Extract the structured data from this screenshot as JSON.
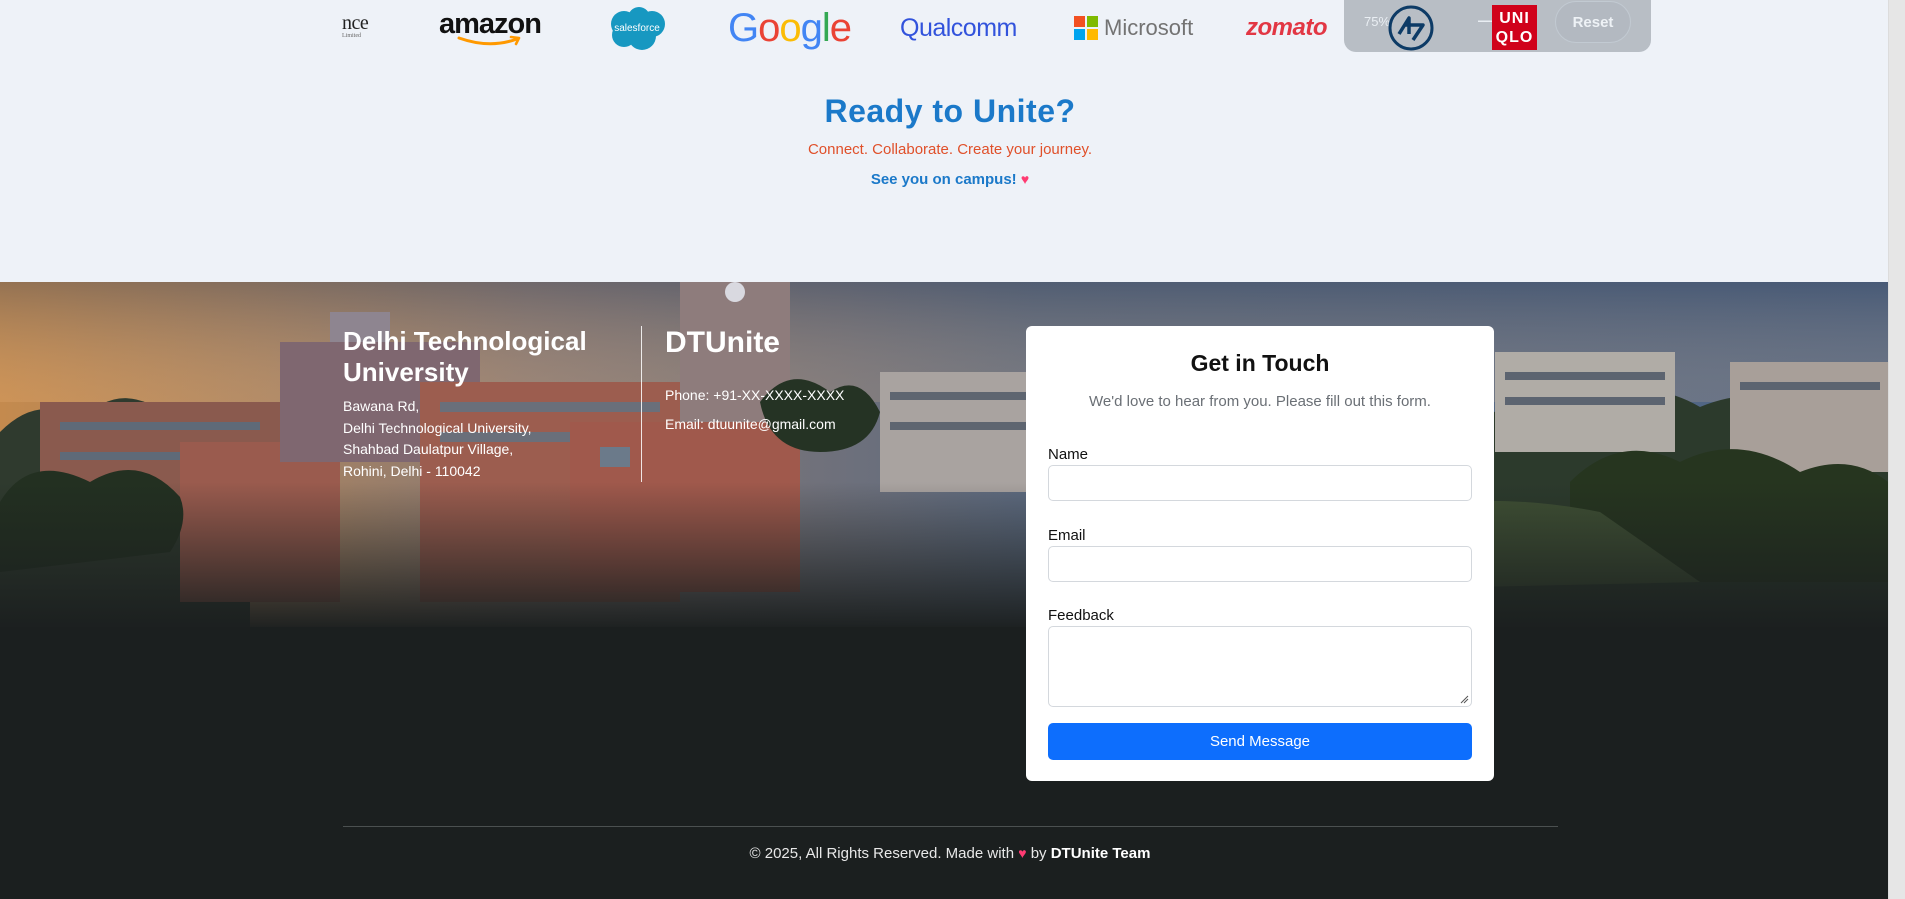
{
  "logos": {
    "ance_text": "nce",
    "ance_sub": "Limited",
    "amazon": "amazon",
    "salesforce": "salesforce",
    "google": [
      "G",
      "o",
      "o",
      "g",
      "l",
      "e"
    ],
    "google_colors": [
      "#4285F4",
      "#EA4335",
      "#FBBC05",
      "#4285F4",
      "#34A853",
      "#EA4335"
    ],
    "qualcomm": "Qualcomm",
    "microsoft": "Microsoft",
    "microsoft_colors": [
      "#F25022",
      "#7FBA00",
      "#00A4EF",
      "#FFB900"
    ],
    "zomato": "zomato",
    "uniqlo_line1": "UNI",
    "uniqlo_line2": "QLO"
  },
  "overlay": {
    "zoom": "75%",
    "minus": "—",
    "reset_label": "Reset"
  },
  "cta": {
    "title": "Ready to Unite?",
    "subtitle": "Connect. Collaborate. Create your journey.",
    "see_you": "See you on campus!",
    "heart": "♥"
  },
  "footer": {
    "university": "Delhi Technological University",
    "address": [
      "Bawana Rd,",
      "Delhi Technological University,",
      "Shahbad Daulatpur Village,",
      "Rohini, Delhi - 110042"
    ],
    "brand": "DTUnite",
    "phone": "Phone: +91-XX-XXXX-XXXX",
    "email": "Email: dtuunite@gmail.com"
  },
  "contact_form": {
    "title": "Get in Touch",
    "subtitle": "We'd love to hear from you. Please fill out this form.",
    "name_label": "Name",
    "name_value": "",
    "email_label": "Email",
    "email_value": "",
    "feedback_label": "Feedback",
    "feedback_value": "",
    "submit_label": "Send Message"
  },
  "copyright": {
    "prefix": "© 2025, All Rights Reserved. Made with",
    "heart": "♥",
    "by": "by",
    "team": "DTUnite Team"
  },
  "colors": {
    "accent_blue": "#1b79c9",
    "subtitle_orange": "#e0502a",
    "button_blue": "#0d6efd",
    "heart_pink": "#ff3b72"
  }
}
